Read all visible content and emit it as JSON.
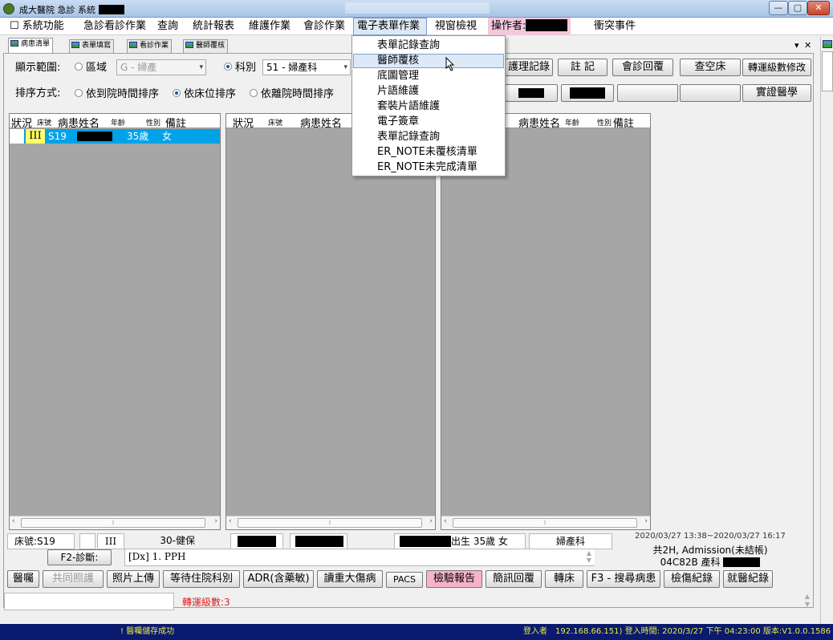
{
  "window": {
    "title": "成大醫院 急診 系統",
    "buttons": [
      "—",
      "▢",
      "✕"
    ]
  },
  "menubar": {
    "items": [
      {
        "label": "☐ 系統功能"
      },
      {
        "label": "急診看診作業"
      },
      {
        "label": "查詢"
      },
      {
        "label": "統計報表"
      },
      {
        "label": "維護作業"
      },
      {
        "label": "會診作業"
      },
      {
        "label": "電子表單作業"
      },
      {
        "label": "視窗檢視"
      },
      {
        "label": "操作者:"
      },
      {
        "label": "衝突事件"
      }
    ]
  },
  "dropdown": {
    "items": [
      {
        "label": "表單記錄查詢"
      },
      {
        "label": "醫師覆核"
      },
      {
        "label": "底圖管理"
      },
      {
        "label": "片語維護"
      },
      {
        "label": "套裝片語維護"
      },
      {
        "label": "電子簽章"
      },
      {
        "label": "表單記錄查詢"
      },
      {
        "label": "ER_NOTE未覆核清單"
      },
      {
        "label": "ER_NOTE未完成清單"
      }
    ],
    "hovered_index": 1
  },
  "tabs": [
    {
      "label": "病患清單"
    },
    {
      "label": "表單填寫"
    },
    {
      "label": "看診作業"
    },
    {
      "label": "醫師覆核"
    }
  ],
  "tab_controls": {
    "dropdown": "▾",
    "close": "✕"
  },
  "filters": {
    "display_range_label": "顯示範圍:",
    "region_label": "區域",
    "region_value": "G - 婦產",
    "dept_label": "科別",
    "dept_value": "51 - 婦產科",
    "sort_label": "排序方式:",
    "sort_options": [
      "依到院時間排序",
      "依床位排序",
      "依離院時間排序"
    ],
    "sort_selected": 1
  },
  "toolbar": {
    "row1": [
      "護理記錄",
      "註 記",
      "會診回覆",
      "查空床",
      "轉運級數修改"
    ],
    "row2_last": "實證醫學"
  },
  "list_headers": {
    "status": "狀況",
    "bed": "床號",
    "name": "病患姓名",
    "age": "年齡",
    "sex": "性別",
    "note": "備註"
  },
  "patients": [
    {
      "level": "III",
      "bed": "S19",
      "age": "35歲",
      "sex": "女"
    }
  ],
  "detail": {
    "bed": "床號:S19",
    "level": "III",
    "insurance": "30-健保",
    "birth_info": "出生 35歲 女",
    "dept": "婦產科",
    "time_range": "2020/03/27 13:38~2020/03/27 16:17",
    "admission": "共2H, Admission(未結帳)",
    "ward": "04C82B 產科",
    "f2_label": "F2-診斷:",
    "dx": "[Dx] 1. PPH"
  },
  "action_buttons": [
    {
      "label": "醫囑"
    },
    {
      "label": "共同照護"
    },
    {
      "label": "照片上傳"
    },
    {
      "label": "等待住院科別"
    },
    {
      "label": "ADR(含藥敏)"
    },
    {
      "label": "讀重大傷病"
    },
    {
      "label": "PACS"
    },
    {
      "label": "檢驗報告"
    },
    {
      "label": "簡訊回覆"
    },
    {
      "label": "轉床"
    },
    {
      "label": "F3 - 搜尋病患"
    },
    {
      "label": "檢傷紀錄"
    },
    {
      "label": "就醫紀錄"
    }
  ],
  "transfer_level": "轉運級數:3",
  "statusbar": {
    "message": "! 醫囑儲存成功",
    "login_label": "登入者",
    "info": "192.168.66.151) 登入時間: 2020/3/27 下午 04:23:00 版本:V1.0.0.1586"
  },
  "colors": {
    "selected_row": "#00a2e8",
    "level_highlight": "#ffff66",
    "statusbar_bg": "#0a1a6e",
    "statusbar_text": "#e8e84a",
    "transfer_text": "#e02020",
    "lab_report_bg": "#f7b3c9"
  }
}
